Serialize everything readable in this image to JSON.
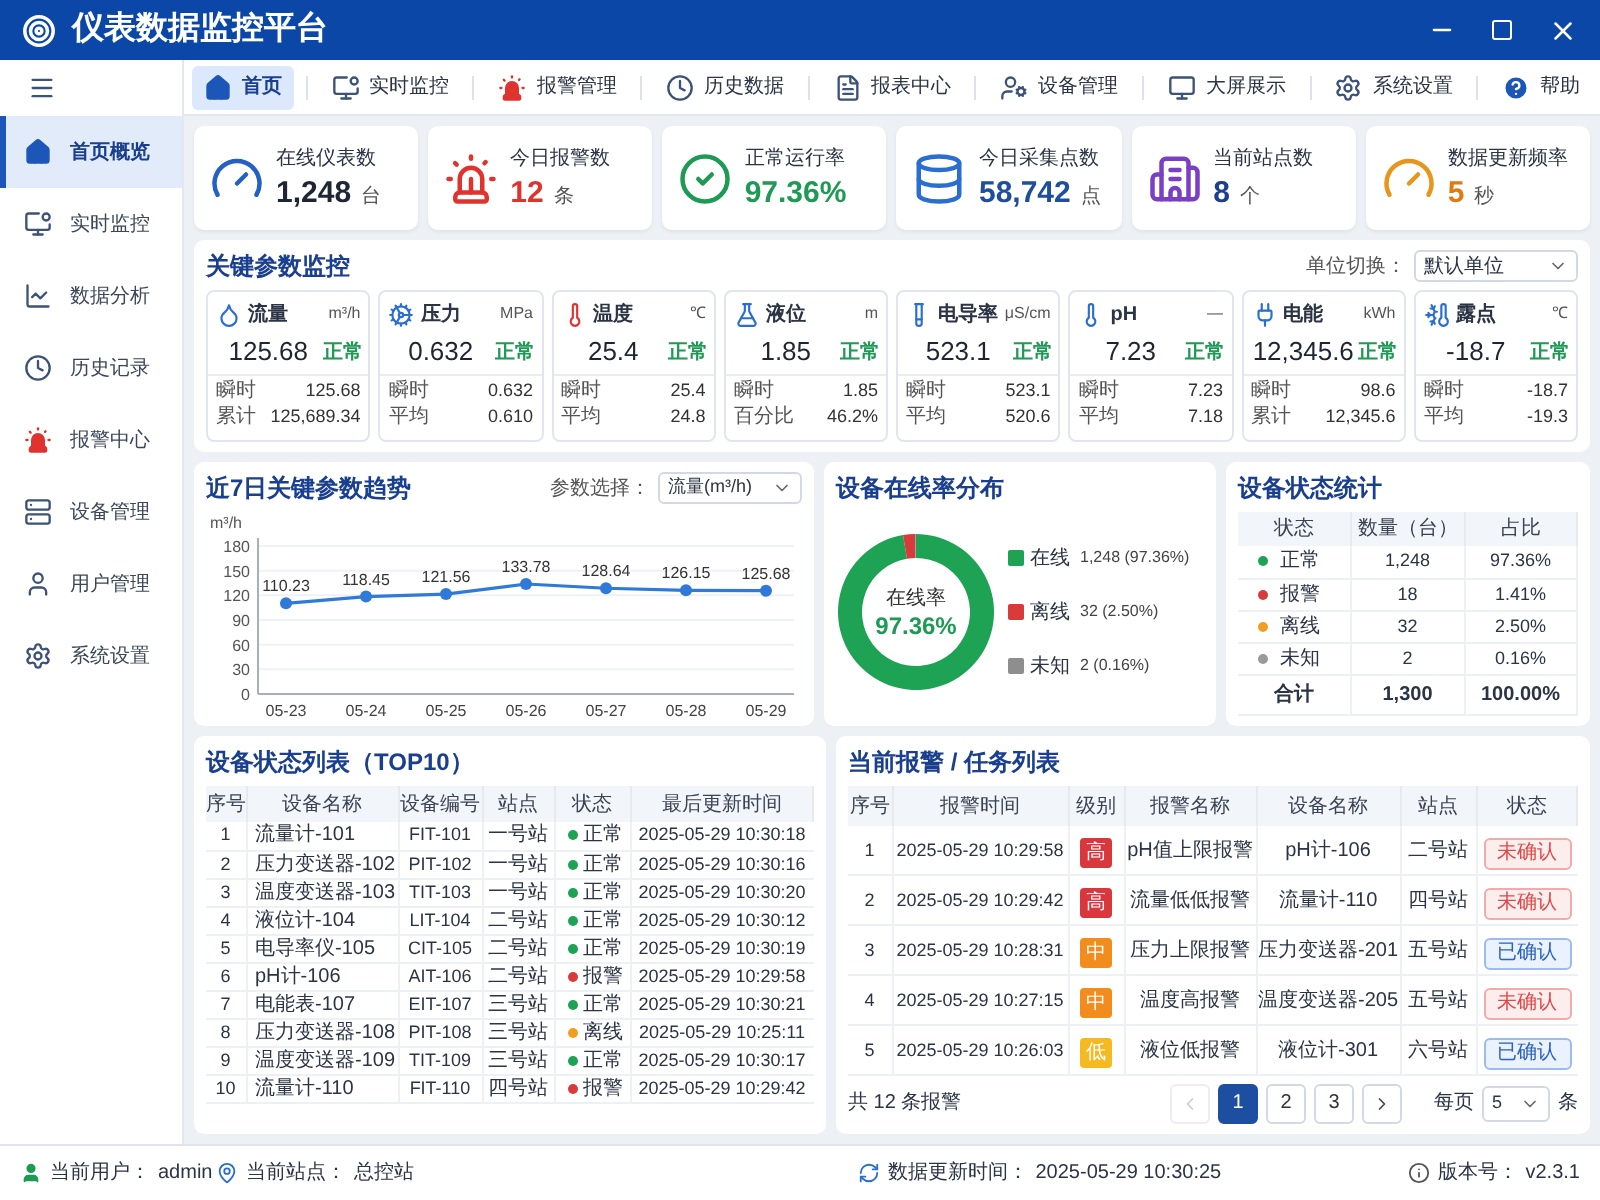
{
  "window": {
    "title": "仪表数据监控平台"
  },
  "nav": [
    {
      "label": "首页",
      "selected": true
    },
    {
      "label": "实时监控",
      "selected": false
    },
    {
      "label": "报警管理",
      "selected": false
    },
    {
      "label": "历史数据",
      "selected": false
    },
    {
      "label": "报表中心",
      "selected": false
    },
    {
      "label": "设备管理",
      "selected": false
    },
    {
      "label": "大屏展示",
      "selected": false
    },
    {
      "label": "系统设置",
      "selected": false
    },
    {
      "label": "帮助",
      "selected": false
    }
  ],
  "sidebar": {
    "items": [
      {
        "label": "首页概览",
        "selected": true
      },
      {
        "label": "实时监控",
        "selected": false
      },
      {
        "label": "数据分析",
        "selected": false
      },
      {
        "label": "历史记录",
        "selected": false
      },
      {
        "label": "报警中心",
        "selected": false
      },
      {
        "label": "设备管理",
        "selected": false
      },
      {
        "label": "用户管理",
        "selected": false
      },
      {
        "label": "系统设置",
        "selected": false
      }
    ]
  },
  "kpis": [
    {
      "label": "在线仪表数",
      "value": "1,248",
      "unit": "台",
      "color": "#1f2633"
    },
    {
      "label": "今日报警数",
      "value": "12",
      "unit": "条",
      "color": "#e0332f"
    },
    {
      "label": "正常运行率",
      "value": "97.36%",
      "color": "#1e9a55"
    },
    {
      "label": "今日采集点数",
      "value": "58,742",
      "unit": "点",
      "color": "#1d4f9e"
    },
    {
      "label": "当前站点数",
      "value": "8",
      "unit": "个",
      "color": "#1d3f8f"
    },
    {
      "label": "数据更新频率",
      "value": "5",
      "unit": "秒",
      "color": "#e07a12"
    }
  ],
  "key_params": {
    "title": "关键参数监控",
    "unit_switch": {
      "label": "单位切换：",
      "value": "默认单位"
    },
    "items": [
      {
        "name": "流量",
        "unit": "m³/h",
        "value": "125.68",
        "status": "正常",
        "rows": [
          {
            "label": "瞬时",
            "value": "125.68"
          },
          {
            "label": "累计",
            "value": "125,689.34"
          }
        ]
      },
      {
        "name": "压力",
        "unit": "MPa",
        "value": "0.632",
        "status": "正常",
        "rows": [
          {
            "label": "瞬时",
            "value": "0.632"
          },
          {
            "label": "平均",
            "value": "0.610"
          }
        ]
      },
      {
        "name": "温度",
        "unit": "℃",
        "value": "25.4",
        "status": "正常",
        "rows": [
          {
            "label": "瞬时",
            "value": "25.4"
          },
          {
            "label": "平均",
            "value": "24.8"
          }
        ]
      },
      {
        "name": "液位",
        "unit": "m",
        "value": "1.85",
        "status": "正常",
        "rows": [
          {
            "label": "瞬时",
            "value": "1.85"
          },
          {
            "label": "百分比",
            "value": "46.2%"
          }
        ]
      },
      {
        "name": "电导率",
        "unit": "μS/cm",
        "value": "523.1",
        "status": "正常",
        "rows": [
          {
            "label": "瞬时",
            "value": "523.1"
          },
          {
            "label": "平均",
            "value": "520.6"
          }
        ]
      },
      {
        "name": "pH",
        "unit": "—",
        "value": "7.23",
        "status": "正常",
        "rows": [
          {
            "label": "瞬时",
            "value": "7.23"
          },
          {
            "label": "平均",
            "value": "7.18"
          }
        ]
      },
      {
        "name": "电能",
        "unit": "kWh",
        "value": "12,345.6",
        "status": "正常",
        "rows": [
          {
            "label": "瞬时",
            "value": "98.6"
          },
          {
            "label": "累计",
            "value": "12,345.6"
          }
        ]
      },
      {
        "name": "露点",
        "unit": "℃",
        "value": "-18.7",
        "status": "正常",
        "rows": [
          {
            "label": "瞬时",
            "value": "-18.7"
          },
          {
            "label": "平均",
            "value": "-19.3"
          }
        ]
      }
    ]
  },
  "trend": {
    "title": "近7日关键参数趋势",
    "param_select": {
      "label": "参数选择：",
      "value": "流量(m³/h)"
    },
    "chart_data": {
      "type": "line",
      "ylabel": "m³/h",
      "categories": [
        "05-23",
        "05-24",
        "05-25",
        "05-26",
        "05-27",
        "05-28",
        "05-29"
      ],
      "series": [
        {
          "color": "#2f7ad8",
          "marker": "circle",
          "values": [
            110.23,
            118.45,
            121.56,
            133.78,
            128.64,
            126.15,
            125.68
          ]
        }
      ],
      "ylim": [
        0,
        180
      ],
      "yticks": [
        0,
        30,
        60,
        90,
        120,
        150,
        180
      ],
      "grid": true,
      "data_labels": true
    }
  },
  "online_rate": {
    "title": "设备在线率分布",
    "center_label": "在线率",
    "center_value": "97.36%",
    "chart_data": {
      "type": "donut",
      "categories": [
        "在线",
        "离线",
        "未知"
      ],
      "values": [
        97.36,
        2.5,
        0.16
      ]
    },
    "legend": [
      {
        "color": "#1ea254",
        "reading": "1,248 (97.36%)"
      },
      {
        "color": "#d93a3a",
        "reading": "32 (2.50%)"
      },
      {
        "color": "#8e8e8e",
        "reading": "2 (0.16%)"
      }
    ]
  },
  "status_stats": {
    "title": "设备状态统计",
    "columns": [
      "状态",
      "数量（台）",
      "占比"
    ],
    "rows": [
      {
        "status": "正常",
        "color": "#1ea254",
        "count": "1,248",
        "share": "97.36%"
      },
      {
        "status": "报警",
        "color": "#d93a3a",
        "count": "18",
        "share": "1.41%"
      },
      {
        "status": "离线",
        "color": "#f0a020",
        "count": "32",
        "share": "2.50%"
      },
      {
        "status": "未知",
        "color": "#9a9a9a",
        "count": "2",
        "share": "0.16%"
      }
    ],
    "total": {
      "label": "合计",
      "count": "1,300",
      "share": "100.00%"
    }
  },
  "device_list": {
    "title": "设备状态列表（TOP10）",
    "columns": [
      "序号",
      "设备名称",
      "设备编号",
      "站点",
      "状态",
      "最后更新时间"
    ],
    "rows": [
      {
        "no": "1",
        "name": "流量计-101",
        "code": "FIT-101",
        "station": "一号站",
        "status": "正常",
        "color": "#1ea254",
        "updated": "2025-05-29 10:30:18"
      },
      {
        "no": "2",
        "name": "压力变送器-102",
        "code": "PIT-102",
        "station": "一号站",
        "status": "正常",
        "color": "#1ea254",
        "updated": "2025-05-29 10:30:16"
      },
      {
        "no": "3",
        "name": "温度变送器-103",
        "code": "TIT-103",
        "station": "一号站",
        "status": "正常",
        "color": "#1ea254",
        "updated": "2025-05-29 10:30:20"
      },
      {
        "no": "4",
        "name": "液位计-104",
        "code": "LIT-104",
        "station": "二号站",
        "status": "正常",
        "color": "#1ea254",
        "updated": "2025-05-29 10:30:12"
      },
      {
        "no": "5",
        "name": "电导率仪-105",
        "code": "CIT-105",
        "station": "二号站",
        "status": "正常",
        "color": "#1ea254",
        "updated": "2025-05-29 10:30:19"
      },
      {
        "no": "6",
        "name": "pH计-106",
        "code": "AIT-106",
        "station": "二号站",
        "status": "报警",
        "color": "#d93a3a",
        "updated": "2025-05-29 10:29:58"
      },
      {
        "no": "7",
        "name": "电能表-107",
        "code": "EIT-107",
        "station": "三号站",
        "status": "正常",
        "color": "#1ea254",
        "updated": "2025-05-29 10:30:21"
      },
      {
        "no": "8",
        "name": "压力变送器-108",
        "code": "PIT-108",
        "station": "三号站",
        "status": "离线",
        "color": "#f0a020",
        "updated": "2025-05-29 10:25:11"
      },
      {
        "no": "9",
        "name": "温度变送器-109",
        "code": "TIT-109",
        "station": "三号站",
        "status": "正常",
        "color": "#1ea254",
        "updated": "2025-05-29 10:30:17"
      },
      {
        "no": "10",
        "name": "流量计-110",
        "code": "FIT-110",
        "station": "四号站",
        "status": "报警",
        "color": "#d93a3a",
        "updated": "2025-05-29 10:29:42"
      }
    ]
  },
  "alarms": {
    "title": "当前报警 / 任务列表",
    "columns": [
      "序号",
      "报警时间",
      "级别",
      "报警名称",
      "设备名称",
      "站点",
      "状态"
    ],
    "rows": [
      {
        "no": "1",
        "time": "2025-05-29 10:29:58",
        "grade": "高",
        "color": "#d9363e",
        "name": "pH值上限报警",
        "device": "pH计-106",
        "station": "二号站",
        "status": "未确认",
        "confirmed": false
      },
      {
        "no": "2",
        "time": "2025-05-29 10:29:42",
        "grade": "高",
        "color": "#d9363e",
        "name": "流量低低报警",
        "device": "流量计-110",
        "station": "四号站",
        "status": "未确认",
        "confirmed": false
      },
      {
        "no": "3",
        "time": "2025-05-29 10:28:31",
        "grade": "中",
        "color": "#f28c1c",
        "name": "压力上限报警",
        "device": "压力变送器-201",
        "station": "五号站",
        "status": "已确认",
        "confirmed": true
      },
      {
        "no": "4",
        "time": "2025-05-29 10:27:15",
        "grade": "中",
        "color": "#f28c1c",
        "name": "温度高报警",
        "device": "温度变送器-205",
        "station": "五号站",
        "status": "未确认",
        "confirmed": false
      },
      {
        "no": "5",
        "time": "2025-05-29 10:26:03",
        "grade": "低",
        "color": "#f5b921",
        "name": "液位低报警",
        "device": "液位计-301",
        "station": "六号站",
        "status": "已确认",
        "confirmed": true
      }
    ],
    "pagination": {
      "total": "共 12 条报警",
      "prev": {
        "disabled": true
      },
      "pages": [
        {
          "label": "1",
          "selected": true
        },
        {
          "label": "2",
          "selected": false
        },
        {
          "label": "3",
          "selected": false
        }
      ],
      "next": {
        "disabled": false
      },
      "per_page": {
        "label": "每页",
        "value": "5",
        "unit": "条"
      }
    }
  },
  "status_bar": {
    "user": {
      "label": "当前用户：",
      "value": "admin"
    },
    "station": {
      "label": "当前站点：",
      "value": "总控站"
    },
    "updated": {
      "label": "数据更新时间：",
      "value": "2025-05-29 10:30:25"
    },
    "version": {
      "label": "版本号：",
      "value": "v2.3.1"
    }
  }
}
